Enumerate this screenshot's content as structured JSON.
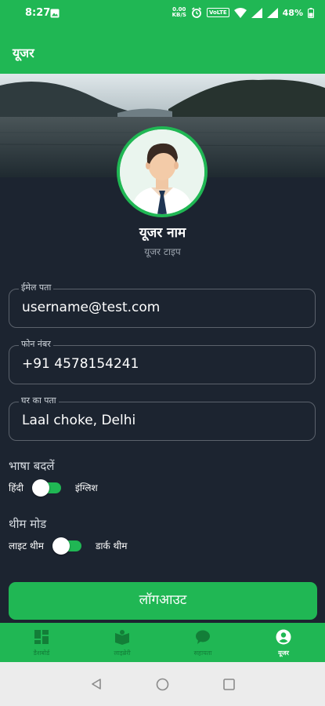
{
  "status_bar": {
    "time": "8:27",
    "net_speed": "0.00",
    "net_unit": "KB/S",
    "volte": "VoLTE",
    "battery": "48%"
  },
  "appbar": {
    "title": "यूजर"
  },
  "profile": {
    "name": "यूजर नाम",
    "type": "यूजर टाइप"
  },
  "fields": {
    "email": {
      "label": "ईमेल पता",
      "value": "username@test.com"
    },
    "phone": {
      "label": "फोन नंबर",
      "value": "+91 4578154241"
    },
    "address": {
      "label": "घर का पता",
      "value": "Laal choke, Delhi"
    }
  },
  "language": {
    "title": "भाषा बदलें",
    "left": "हिंदी",
    "right": "इंग्लिश",
    "state": "on"
  },
  "theme": {
    "title": "थीम मोड",
    "left": "लाइट थीम",
    "right": "डार्क थीम",
    "state": "on"
  },
  "logout_label": "लॉगआउट",
  "bottom_nav": [
    {
      "label": "डैशबोर्ड",
      "icon": "dashboard-icon"
    },
    {
      "label": "लाइब्रेरी",
      "icon": "library-icon"
    },
    {
      "label": "सहायता",
      "icon": "chat-icon"
    },
    {
      "label": "यूजर",
      "icon": "account-icon",
      "active": true
    }
  ],
  "colors": {
    "accent": "#20b754",
    "background": "#1c2430"
  }
}
